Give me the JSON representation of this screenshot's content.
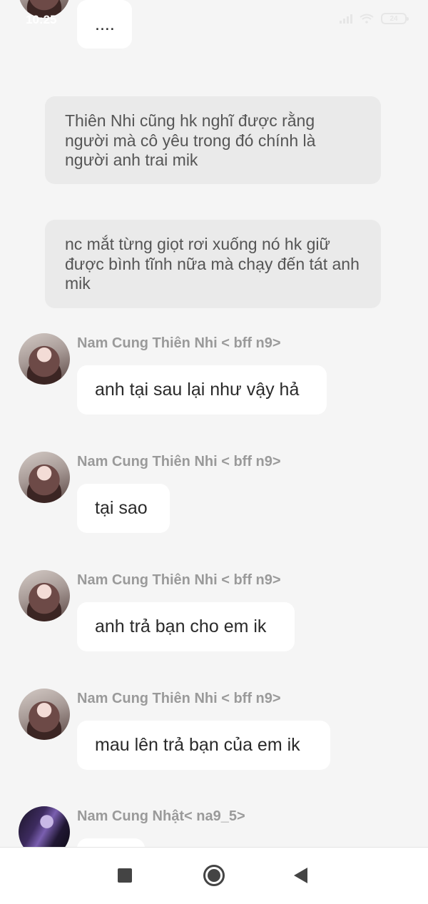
{
  "status_bar": {
    "time": "10:25",
    "battery": "24"
  },
  "messages": [
    {
      "type": "bubble",
      "text": "...."
    },
    {
      "type": "narration",
      "text": "Thiên Nhi cũng hk nghĩ được rằng người mà cô yêu trong đó chính là người anh trai mik"
    },
    {
      "type": "narration",
      "text": "nc mắt từng giọt rơi xuống nó hk giữ được bình tĩnh nữa mà chạy đến tát anh mik"
    },
    {
      "type": "message",
      "sender": "Nam Cung Thiên Nhi < bff n9>",
      "text": "anh tại sau lại như vậy hả",
      "avatar": "girl-avatar"
    },
    {
      "type": "message",
      "sender": "Nam Cung Thiên Nhi < bff n9>",
      "text": "tại sao",
      "avatar": "girl-avatar"
    },
    {
      "type": "message",
      "sender": "Nam Cung Thiên Nhi < bff n9>",
      "text": "anh trả bạn cho em ik",
      "avatar": "girl-avatar"
    },
    {
      "type": "message",
      "sender": "Nam Cung Thiên Nhi < bff n9>",
      "text": "mau lên trả bạn của em ik",
      "avatar": "girl-avatar"
    },
    {
      "type": "message",
      "sender": "Nam Cung Nhật< na9_5>",
      "text": "",
      "avatar": "boy-avatar"
    }
  ],
  "nav_bar": {
    "icons": [
      "recent-apps-icon",
      "home-icon",
      "back-icon"
    ]
  },
  "colors": {
    "background": "#f5f5f5",
    "bubble": "#ffffff",
    "narration_bubble": "#eaeaea",
    "sender_name": "#9a9a9a"
  }
}
